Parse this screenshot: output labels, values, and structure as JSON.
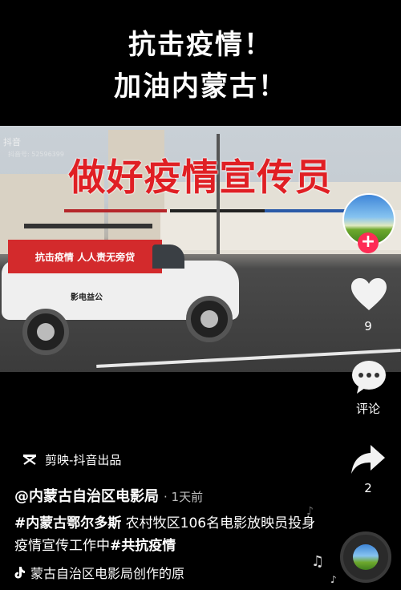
{
  "header": {
    "line1": "抗击疫情！",
    "line2": "加油内蒙古！"
  },
  "video": {
    "watermark": "抖音",
    "watermark_sub": "抖音号: 52596399",
    "banner": "做好疫情宣传员",
    "car_banner": "抗击疫情  人人责无旁贷",
    "car_label": "影电益公"
  },
  "rail": {
    "like_count": "9",
    "comment_label": "评论",
    "share_count": "2"
  },
  "info": {
    "capcut_label": "剪映-抖音出品",
    "author": "@内蒙古自治区电影局",
    "time": "· 1天前",
    "hashtag1": "#内蒙古鄂尔多斯",
    "desc_text": " 农村牧区106名电影放映员投身疫情宣传工作中",
    "hashtag2": "#共抗疫情",
    "music": "蒙古自治区电影局创作的原"
  },
  "colors": {
    "accent": "#fe2c55",
    "banner_red": "#e01f24"
  }
}
